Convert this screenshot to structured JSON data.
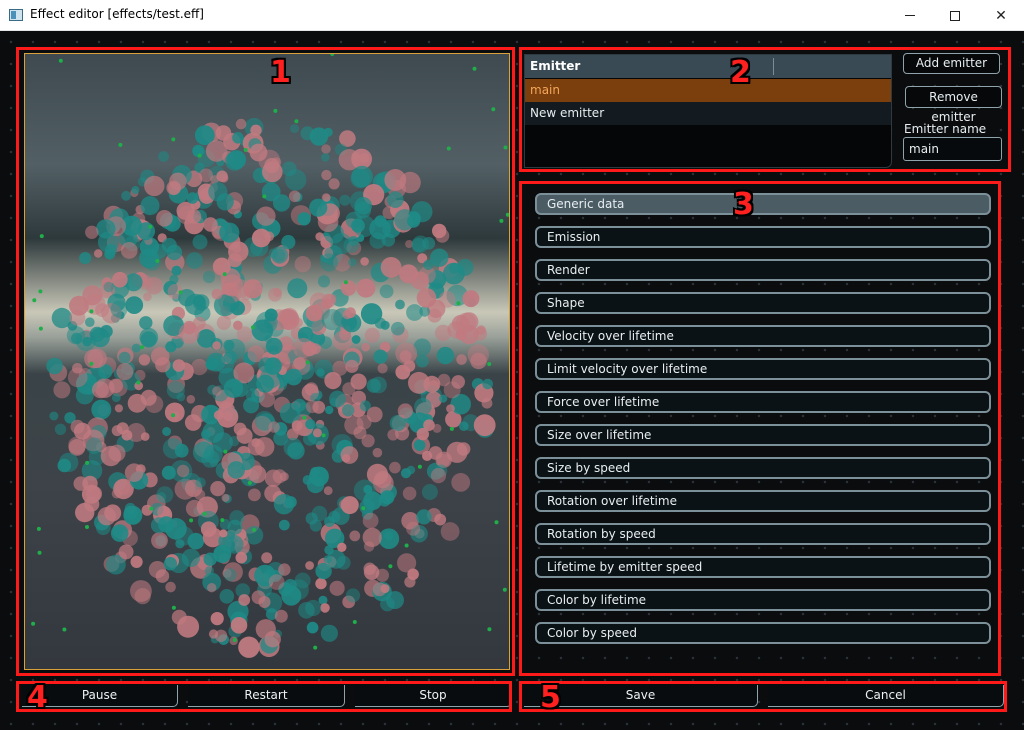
{
  "window": {
    "title": "Effect editor [effects/test.eff]"
  },
  "annotations": {
    "box1": "1",
    "box2": "2",
    "box3": "3",
    "box4": "4",
    "box5": "5"
  },
  "emitters": {
    "header": "Emitter",
    "rows": [
      "main",
      "New emitter"
    ],
    "selected": "main",
    "add_label": "Add emitter",
    "remove_label": "Remove emitter",
    "name_label": "Emitter name",
    "name_value": "main"
  },
  "sections": [
    "Generic data",
    "Emission",
    "Render",
    "Shape",
    "Velocity over lifetime",
    "Limit velocity over lifetime",
    "Force over lifetime",
    "Size over lifetime",
    "Size by speed",
    "Rotation over lifetime",
    "Rotation by speed",
    "Lifetime by emitter speed",
    "Color by lifetime",
    "Color by speed"
  ],
  "playback": {
    "pause": "Pause",
    "restart": "Restart",
    "stop": "Stop"
  },
  "dialog": {
    "save": "Save",
    "cancel": "Cancel"
  },
  "colors": {
    "annotation_red": "#ff1a1a",
    "selected_row_bg": "#7a3f0c",
    "selected_row_text": "#f4a65a",
    "particle_teal": "#1f8a86",
    "particle_pink": "#c07a80"
  }
}
